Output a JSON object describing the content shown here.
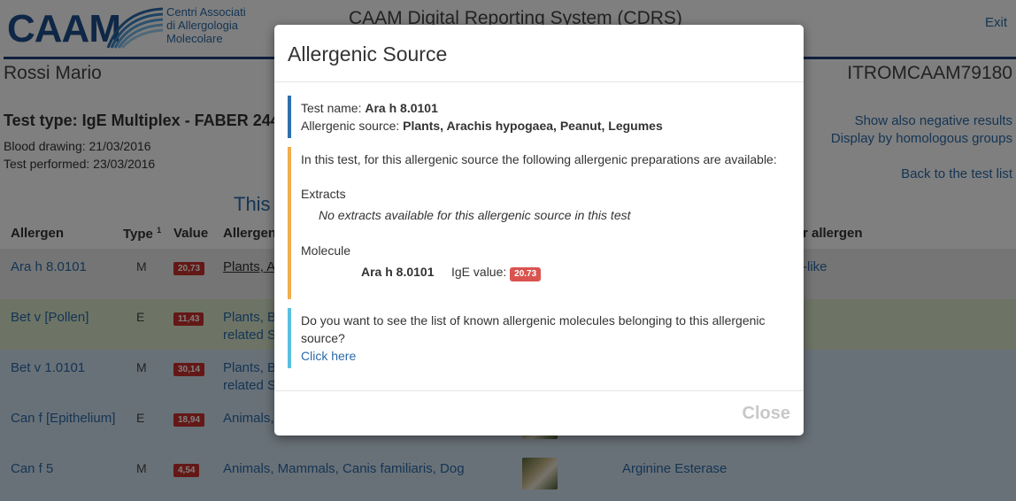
{
  "header": {
    "logo_text": "CAAM",
    "logo_sub": [
      "Centri Associati",
      "di Allergologia",
      "Molecolare"
    ],
    "app_title": "CAAM Digital Reporting System (CDRS)",
    "exit_label": "Exit"
  },
  "patient": {
    "name": "Rossi Mario",
    "id": "ITROMCAAM79180"
  },
  "test": {
    "type": "Test type: IgE Multiplex - FABER 244-",
    "blood_drawing": "Blood drawing: 21/03/2016",
    "performed": "Test performed: 23/03/2016"
  },
  "side_links": {
    "show_negative": "Show also negative results",
    "by_homologous": "Display by homologous groups",
    "back": "Back to the test list"
  },
  "section_title": "This i",
  "table": {
    "headers": {
      "allergen": "Allergen",
      "type": "Type",
      "type_sup": "1",
      "value": "Value",
      "source": "Allergeni",
      "similar": "r allergen"
    },
    "rows": [
      {
        "allergen": "Ara h 8.0101",
        "type": "M",
        "value": "20,73",
        "source_line1": "Plants, Ar",
        "source_line2": "",
        "similar": "-like",
        "bg": "#ebebeb"
      },
      {
        "allergen": "Bet v [Pollen]",
        "type": "E",
        "value": "11,43",
        "source_line1": "Plants, Be",
        "source_line2": "related Sp",
        "similar": "",
        "bg": "#dbe8cc"
      },
      {
        "allergen": "Bet v 1.0101",
        "type": "M",
        "value": "30,14",
        "source_line1": "Plants, Be",
        "source_line2": "related Sp",
        "similar": "",
        "bg": "#d3e2f0"
      },
      {
        "allergen": "Can f [Epithelium]",
        "type": "E",
        "value": "18,94",
        "source_line1": "Animals,",
        "source_line2": "",
        "similar": "",
        "bg": "#d3e2f0"
      },
      {
        "allergen": "Can f 5",
        "type": "M",
        "value": "4,54",
        "source_line1": "Animals, Mammals, Canis familiaris, Dog",
        "source_line2": "",
        "similar": "Arginine Esterase",
        "bg": "#d3e2f0"
      }
    ]
  },
  "modal": {
    "title": "Allergenic Source",
    "test_name_label": "Test name:",
    "test_name_value": "Ara h 8.0101",
    "source_label": "Allergenic source:",
    "source_value": "Plants, Arachis hypogaea, Peanut, Legumes",
    "intro": "In this test, for this allergenic source the following allergenic preparations are available:",
    "extracts_label": "Extracts",
    "extracts_none": "No extracts available for this allergenic source in this test",
    "molecule_label": "Molecule",
    "molecule_name": "Ara h 8.0101",
    "ige_label": "IgE value:",
    "ige_value": "20.73",
    "question_line1": "Do you want to see the list of known allergenic molecules belonging to this allergenic",
    "question_line2": "source?",
    "click_here": "Click here",
    "close_label": "Close"
  },
  "colors": {
    "brand_blue": "#1e4f8d",
    "link_blue": "#2a6aa8",
    "callout_blue": "#2f6fad",
    "callout_orange": "#f0ad4e",
    "callout_cyan": "#5bc0de",
    "value_red": "#c9302c"
  }
}
